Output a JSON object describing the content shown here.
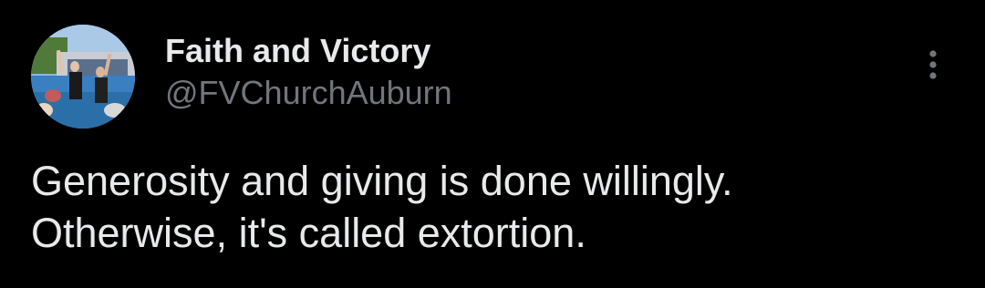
{
  "tweet": {
    "author": {
      "display_name": "Faith and Victory",
      "handle": "@FVChurchAuburn",
      "avatar_icon": "profile-photo"
    },
    "more_icon": "vertical-ellipsis-icon",
    "text_lines": [
      "Generosity and giving is done willingly.",
      "Otherwise, it's called extortion."
    ]
  },
  "colors": {
    "background": "#000000",
    "primary_text": "#e7e9ea",
    "secondary_text": "#71767b"
  }
}
